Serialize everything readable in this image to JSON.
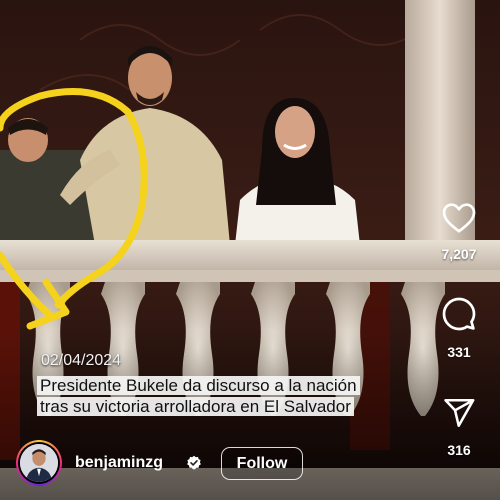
{
  "post": {
    "date": "02/04/2024",
    "caption": "Presidente Bukele da discurso a la nación tras su victoria arrolladora en El Salvador"
  },
  "actions": {
    "like_count": "7,207",
    "comment_count": "331",
    "share_count": "316",
    "like_icon": "heart-outline-icon",
    "comment_icon": "speech-bubble-icon",
    "share_icon": "paper-plane-icon"
  },
  "author": {
    "username": "benjaminzg",
    "verified": true,
    "follow_label": "Follow"
  },
  "colors": {
    "annotation_circle": "#f5d21c",
    "caption_highlight": "#f5f5f5",
    "story_ring": "#ee2a7b",
    "text": "#ffffff"
  }
}
